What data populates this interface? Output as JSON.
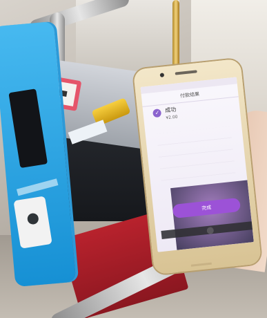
{
  "payment": {
    "nav_title": "付款结果",
    "merchant": "成功",
    "amount": "¥2.00",
    "confirm_label": "完成"
  }
}
